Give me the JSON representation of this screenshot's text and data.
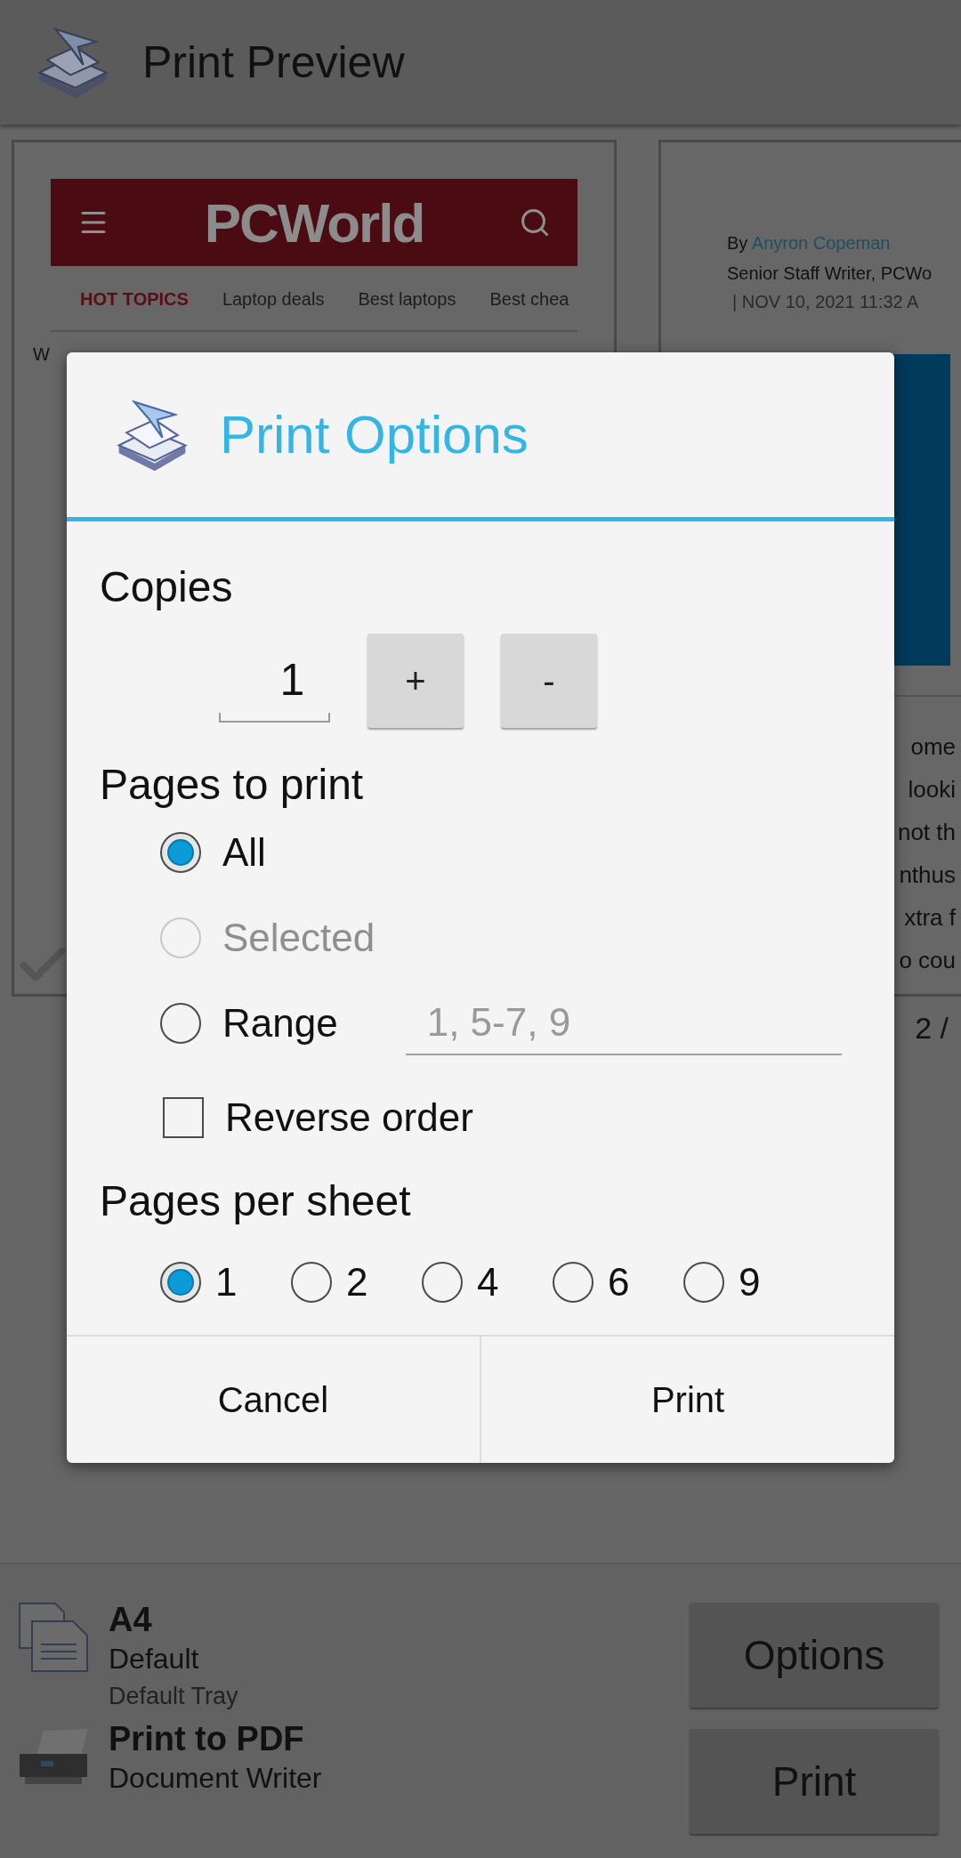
{
  "app_bar": {
    "title": "Print Preview"
  },
  "preview": {
    "page_1": {
      "site_name": "PCWorld",
      "nav": [
        {
          "label": "HOT TOPICS",
          "kind": "highlight"
        },
        {
          "label": "Laptop deals",
          "kind": "link"
        },
        {
          "label": "Best laptops",
          "kind": "link"
        },
        {
          "label": "Best chea",
          "kind": "link"
        }
      ],
      "fragment": "W"
    },
    "page_2": {
      "byline_prefix": "By",
      "author": "Anyron Copeman",
      "role": "Senior Staff Writer, PCWo",
      "date": "| NOV 10, 2021 11:32 A",
      "text_fragments": [
        "ome",
        "looki",
        "not th",
        "nthus",
        "xtra f",
        "o cou"
      ]
    },
    "page_indicator": "2 /"
  },
  "bottom_bar": {
    "paper": "A4",
    "paper_type": "Default",
    "tray": "Default Tray",
    "printer": "Print to PDF",
    "printer_type": "Document Writer",
    "buttons": [
      "Options",
      "Print"
    ]
  },
  "dialog": {
    "title": "Print Options",
    "copies_label": "Copies",
    "copies_value": "1",
    "copies_buttons": [
      "+",
      "-"
    ],
    "pages_label": "Pages to print",
    "page_options": [
      {
        "label": "All",
        "selected": true,
        "disabled": false
      },
      {
        "label": "Selected",
        "selected": false,
        "disabled": true
      },
      {
        "label": "Range",
        "selected": false,
        "disabled": false
      }
    ],
    "range_placeholder": "1, 5-7, 9",
    "reverse_order": {
      "label": "Reverse order",
      "checked": false
    },
    "per_sheet_label": "Pages per sheet",
    "per_sheet_options": [
      {
        "label": "1",
        "selected": true
      },
      {
        "label": "2",
        "selected": false
      },
      {
        "label": "4",
        "selected": false
      },
      {
        "label": "6",
        "selected": false
      },
      {
        "label": "9",
        "selected": false
      }
    ],
    "buttons": [
      "Cancel",
      "Print"
    ]
  }
}
